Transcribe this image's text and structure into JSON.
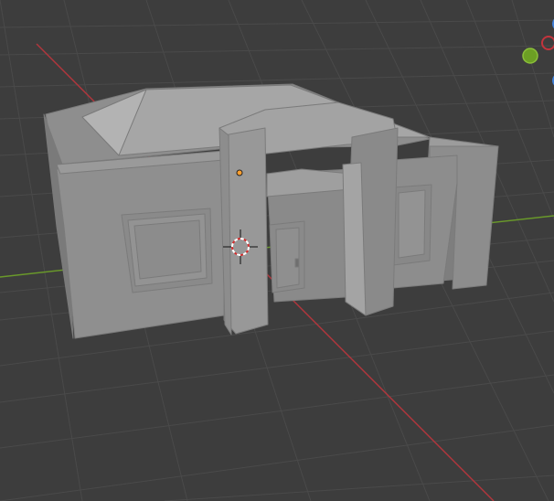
{
  "editor": {
    "type": "3D Viewport",
    "shading_mode": "solid",
    "background_color": "#3d3d3d",
    "grid_line_color": "#4a4a4a"
  },
  "axes": {
    "x_axis_color": "#b3363d",
    "y_axis_color": "#6a9a2a",
    "show_x_axis_line": true,
    "show_y_axis_line": true
  },
  "scene": {
    "object_type": "building",
    "object_color": "#9a9a9a",
    "selected": false,
    "origin_marker_color": "#ff9f2e",
    "has_3d_cursor": true
  },
  "navigation_gizmo": {
    "visible": true,
    "colors": {
      "x": "#c2343d",
      "y": "#6c9f24",
      "z": "#3f7fd8"
    }
  },
  "icons": [
    "3d-cursor-icon",
    "object-origin-icon",
    "navigation-gizmo-icon"
  ]
}
